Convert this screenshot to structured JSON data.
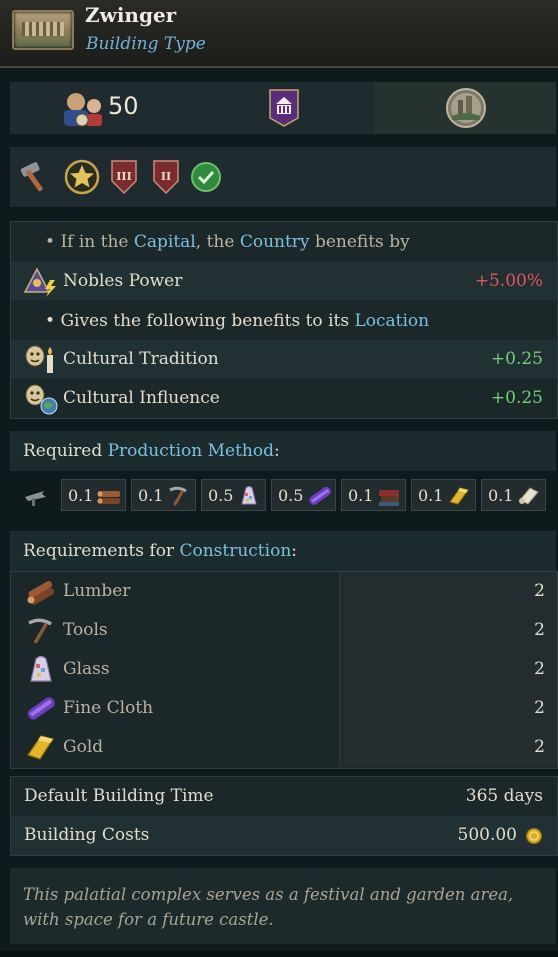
{
  "header": {
    "title": "Zwinger",
    "subtitle": "Building Type"
  },
  "stats": {
    "population": "50"
  },
  "modifiers": {
    "capital_line": {
      "bullet": "•",
      "pre": "If in the",
      "capital": "Capital",
      "mid": ", the",
      "country": "Country",
      "post": "benefits by"
    },
    "nobles_power": {
      "label": "Nobles Power",
      "value": "+5.00%"
    },
    "location_line": {
      "bullet": "•",
      "pre": "Gives the following benefits to its",
      "location": "Location"
    },
    "cultural_tradition": {
      "label": "Cultural Tradition",
      "value": "+0.25"
    },
    "cultural_influence": {
      "label": "Cultural Influence",
      "value": "+0.25"
    }
  },
  "production": {
    "heading_pre": "Required",
    "heading_hl": "Production Method",
    "heading_post": ":",
    "inputs": [
      {
        "amount": "0.1",
        "icon": "lumber-icon"
      },
      {
        "amount": "0.1",
        "icon": "tools-icon"
      },
      {
        "amount": "0.5",
        "icon": "glass-icon"
      },
      {
        "amount": "0.5",
        "icon": "fine-cloth-icon"
      },
      {
        "amount": "0.1",
        "icon": "books-icon"
      },
      {
        "amount": "0.1",
        "icon": "gold-icon"
      },
      {
        "amount": "0.1",
        "icon": "paper-icon"
      }
    ]
  },
  "construction": {
    "heading_pre": "Requirements for",
    "heading_hl": "Construction",
    "heading_post": ":",
    "items": [
      {
        "name": "Lumber",
        "amount": "2"
      },
      {
        "name": "Tools",
        "amount": "2"
      },
      {
        "name": "Glass",
        "amount": "2"
      },
      {
        "name": "Fine Cloth",
        "amount": "2"
      },
      {
        "name": "Gold",
        "amount": "2"
      }
    ]
  },
  "costs": {
    "time_label": "Default Building Time",
    "time_value": "365 days",
    "cost_label": "Building Costs",
    "cost_value": "500.00"
  },
  "description": "This palatial complex serves as a festival and garden area, with space for a future castle.",
  "colors": {
    "highlight": "#7cc0e0",
    "negative": "#e0575a",
    "positive": "#6fd07a",
    "background": "#0f1a1d"
  }
}
